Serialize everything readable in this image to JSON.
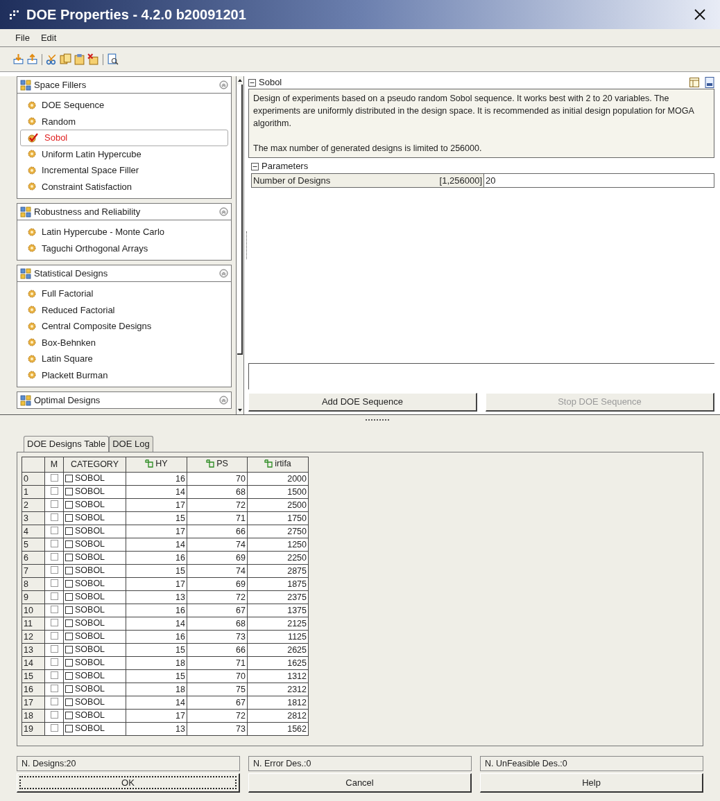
{
  "window": {
    "title": "DOE Properties - 4.2.0 b20091201"
  },
  "menu": [
    "File",
    "Edit"
  ],
  "groups": [
    {
      "title": "Space Fillers",
      "items": [
        {
          "label": "DOE Sequence",
          "selected": false
        },
        {
          "label": "Random",
          "selected": false
        },
        {
          "label": "Sobol",
          "selected": true
        },
        {
          "label": "Uniform Latin Hypercube",
          "selected": false
        },
        {
          "label": "Incremental Space Filler",
          "selected": false
        },
        {
          "label": "Constraint Satisfaction",
          "selected": false
        }
      ]
    },
    {
      "title": "Robustness and Reliability",
      "items": [
        {
          "label": "Latin Hypercube - Monte Carlo",
          "selected": false
        },
        {
          "label": "Taguchi Orthogonal Arrays",
          "selected": false
        }
      ]
    },
    {
      "title": "Statistical Designs",
      "items": [
        {
          "label": "Full Factorial",
          "selected": false
        },
        {
          "label": "Reduced Factorial",
          "selected": false
        },
        {
          "label": "Central Composite Designs",
          "selected": false
        },
        {
          "label": "Box-Behnken",
          "selected": false
        },
        {
          "label": "Latin Square",
          "selected": false
        },
        {
          "label": "Plackett Burman",
          "selected": false
        }
      ]
    },
    {
      "title": "Optimal Designs"
    }
  ],
  "detail": {
    "title": "Sobol",
    "description": [
      "Design of experiments based on a pseudo random Sobol sequence. It works best with 2 to 20 variables. The experiments are uniformly distributed in the design space. It is recommended as initial design population for MOGA algorithm.",
      "The max number of generated designs is limited to 256000."
    ],
    "parameters_title": "Parameters",
    "parameters": [
      {
        "name": "Number of Designs",
        "range": "[1,256000]",
        "value": "20"
      }
    ]
  },
  "sequence_buttons": [
    {
      "label": "Add DOE Sequence",
      "disabled": false
    },
    {
      "label": "Stop DOE Sequence",
      "disabled": true
    }
  ],
  "tabs": [
    {
      "label": "DOE Designs Table",
      "selected": true
    },
    {
      "label": "DOE Log",
      "selected": false
    }
  ],
  "table": {
    "columns": [
      {
        "label": "M",
        "kind": "plain"
      },
      {
        "label": "CATEGORY",
        "kind": "plain"
      },
      {
        "label": "HY",
        "kind": "variable"
      },
      {
        "label": "PS",
        "kind": "variable"
      },
      {
        "label": "irtifa",
        "kind": "variable"
      }
    ],
    "rows": [
      {
        "index": "0",
        "m": false,
        "cat": false,
        "category": "SOBOL",
        "hy": "16",
        "ps": "70",
        "irtifa": "2000"
      },
      {
        "index": "1",
        "m": false,
        "cat": false,
        "category": "SOBOL",
        "hy": "14",
        "ps": "68",
        "irtifa": "1500"
      },
      {
        "index": "2",
        "m": false,
        "cat": false,
        "category": "SOBOL",
        "hy": "17",
        "ps": "72",
        "irtifa": "2500"
      },
      {
        "index": "3",
        "m": false,
        "cat": false,
        "category": "SOBOL",
        "hy": "15",
        "ps": "71",
        "irtifa": "1750"
      },
      {
        "index": "4",
        "m": false,
        "cat": false,
        "category": "SOBOL",
        "hy": "17",
        "ps": "66",
        "irtifa": "2750"
      },
      {
        "index": "5",
        "m": false,
        "cat": false,
        "category": "SOBOL",
        "hy": "14",
        "ps": "74",
        "irtifa": "1250"
      },
      {
        "index": "6",
        "m": false,
        "cat": false,
        "category": "SOBOL",
        "hy": "16",
        "ps": "69",
        "irtifa": "2250"
      },
      {
        "index": "7",
        "m": false,
        "cat": false,
        "category": "SOBOL",
        "hy": "15",
        "ps": "74",
        "irtifa": "2875"
      },
      {
        "index": "8",
        "m": false,
        "cat": false,
        "category": "SOBOL",
        "hy": "17",
        "ps": "69",
        "irtifa": "1875"
      },
      {
        "index": "9",
        "m": false,
        "cat": false,
        "category": "SOBOL",
        "hy": "13",
        "ps": "72",
        "irtifa": "2375"
      },
      {
        "index": "10",
        "m": false,
        "cat": false,
        "category": "SOBOL",
        "hy": "16",
        "ps": "67",
        "irtifa": "1375"
      },
      {
        "index": "11",
        "m": false,
        "cat": false,
        "category": "SOBOL",
        "hy": "14",
        "ps": "68",
        "irtifa": "2125"
      },
      {
        "index": "12",
        "m": false,
        "cat": false,
        "category": "SOBOL",
        "hy": "16",
        "ps": "73",
        "irtifa": "1125"
      },
      {
        "index": "13",
        "m": false,
        "cat": false,
        "category": "SOBOL",
        "hy": "15",
        "ps": "66",
        "irtifa": "2625"
      },
      {
        "index": "14",
        "m": false,
        "cat": false,
        "category": "SOBOL",
        "hy": "18",
        "ps": "71",
        "irtifa": "1625"
      },
      {
        "index": "15",
        "m": false,
        "cat": false,
        "category": "SOBOL",
        "hy": "15",
        "ps": "70",
        "irtifa": "1312"
      },
      {
        "index": "16",
        "m": false,
        "cat": false,
        "category": "SOBOL",
        "hy": "18",
        "ps": "75",
        "irtifa": "2312"
      },
      {
        "index": "17",
        "m": false,
        "cat": false,
        "category": "SOBOL",
        "hy": "14",
        "ps": "67",
        "irtifa": "1812"
      },
      {
        "index": "18",
        "m": false,
        "cat": false,
        "category": "SOBOL",
        "hy": "17",
        "ps": "72",
        "irtifa": "2812"
      },
      {
        "index": "19",
        "m": false,
        "cat": false,
        "category": "SOBOL",
        "hy": "13",
        "ps": "73",
        "irtifa": "1562"
      }
    ]
  },
  "status": [
    "N. Designs:20",
    "N. Error Des.:0",
    "N. UnFeasible Des.:0"
  ],
  "buttons": [
    {
      "label": "OK",
      "focused": true
    },
    {
      "label": "Cancel",
      "focused": false
    },
    {
      "label": "Help",
      "focused": false
    }
  ]
}
